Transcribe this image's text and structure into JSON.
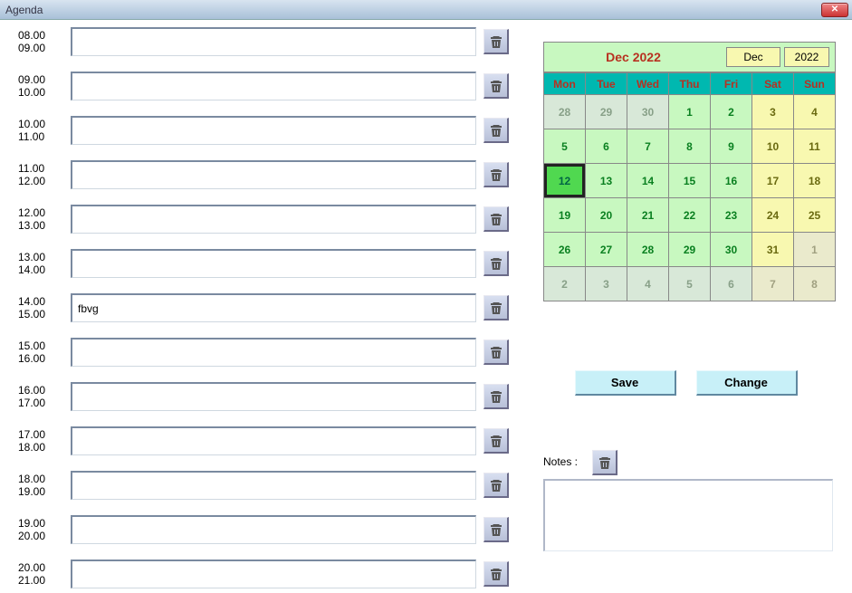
{
  "window": {
    "title": "Agenda",
    "close_icon": "close-icon"
  },
  "slots": [
    {
      "start": "08.00",
      "end": "09.00",
      "value": ""
    },
    {
      "start": "09.00",
      "end": "10.00",
      "value": ""
    },
    {
      "start": "10.00",
      "end": "11.00",
      "value": ""
    },
    {
      "start": "11.00",
      "end": "12.00",
      "value": ""
    },
    {
      "start": "12.00",
      "end": "13.00",
      "value": ""
    },
    {
      "start": "13.00",
      "end": "14.00",
      "value": ""
    },
    {
      "start": "14.00",
      "end": "15.00",
      "value": "fbvg"
    },
    {
      "start": "15.00",
      "end": "16.00",
      "value": ""
    },
    {
      "start": "16.00",
      "end": "17.00",
      "value": ""
    },
    {
      "start": "17.00",
      "end": "18.00",
      "value": ""
    },
    {
      "start": "18.00",
      "end": "19.00",
      "value": ""
    },
    {
      "start": "19.00",
      "end": "20.00",
      "value": ""
    },
    {
      "start": "20.00",
      "end": "21.00",
      "value": ""
    }
  ],
  "calendar": {
    "title": "Dec 2022",
    "month_sel": "Dec",
    "year_sel": "2022",
    "day_headers": [
      "Mon",
      "Tue",
      "Wed",
      "Thu",
      "Fri",
      "Sat",
      "Sun"
    ],
    "selected": 12,
    "cells": [
      {
        "d": 28,
        "other": true,
        "weekend": false
      },
      {
        "d": 29,
        "other": true,
        "weekend": false
      },
      {
        "d": 30,
        "other": true,
        "weekend": false
      },
      {
        "d": 1,
        "other": false,
        "weekend": false
      },
      {
        "d": 2,
        "other": false,
        "weekend": false
      },
      {
        "d": 3,
        "other": false,
        "weekend": true
      },
      {
        "d": 4,
        "other": false,
        "weekend": true
      },
      {
        "d": 5,
        "other": false,
        "weekend": false
      },
      {
        "d": 6,
        "other": false,
        "weekend": false
      },
      {
        "d": 7,
        "other": false,
        "weekend": false
      },
      {
        "d": 8,
        "other": false,
        "weekend": false
      },
      {
        "d": 9,
        "other": false,
        "weekend": false
      },
      {
        "d": 10,
        "other": false,
        "weekend": true
      },
      {
        "d": 11,
        "other": false,
        "weekend": true
      },
      {
        "d": 12,
        "other": false,
        "weekend": false
      },
      {
        "d": 13,
        "other": false,
        "weekend": false
      },
      {
        "d": 14,
        "other": false,
        "weekend": false
      },
      {
        "d": 15,
        "other": false,
        "weekend": false
      },
      {
        "d": 16,
        "other": false,
        "weekend": false
      },
      {
        "d": 17,
        "other": false,
        "weekend": true
      },
      {
        "d": 18,
        "other": false,
        "weekend": true
      },
      {
        "d": 19,
        "other": false,
        "weekend": false
      },
      {
        "d": 20,
        "other": false,
        "weekend": false
      },
      {
        "d": 21,
        "other": false,
        "weekend": false
      },
      {
        "d": 22,
        "other": false,
        "weekend": false
      },
      {
        "d": 23,
        "other": false,
        "weekend": false
      },
      {
        "d": 24,
        "other": false,
        "weekend": true
      },
      {
        "d": 25,
        "other": false,
        "weekend": true
      },
      {
        "d": 26,
        "other": false,
        "weekend": false
      },
      {
        "d": 27,
        "other": false,
        "weekend": false
      },
      {
        "d": 28,
        "other": false,
        "weekend": false
      },
      {
        "d": 29,
        "other": false,
        "weekend": false
      },
      {
        "d": 30,
        "other": false,
        "weekend": false
      },
      {
        "d": 31,
        "other": false,
        "weekend": true
      },
      {
        "d": 1,
        "other": true,
        "weekend": true
      },
      {
        "d": 2,
        "other": true,
        "weekend": false
      },
      {
        "d": 3,
        "other": true,
        "weekend": false
      },
      {
        "d": 4,
        "other": true,
        "weekend": false
      },
      {
        "d": 5,
        "other": true,
        "weekend": false
      },
      {
        "d": 6,
        "other": true,
        "weekend": false
      },
      {
        "d": 7,
        "other": true,
        "weekend": true
      },
      {
        "d": 8,
        "other": true,
        "weekend": true
      }
    ]
  },
  "actions": {
    "save_label": "Save",
    "change_label": "Change"
  },
  "notes": {
    "label": "Notes :",
    "value": ""
  },
  "icons": {
    "trash": "trash-icon"
  }
}
